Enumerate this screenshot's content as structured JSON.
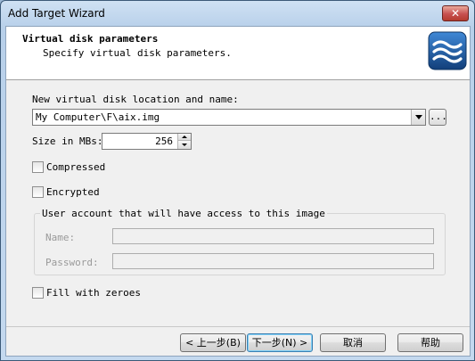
{
  "window": {
    "title": "Add Target Wizard",
    "close_label": "✕"
  },
  "header": {
    "title": "Virtual disk parameters",
    "subtitle": "Specify virtual disk parameters.",
    "icon": "waves-logo-icon"
  },
  "location": {
    "label": "New virtual disk location and name:",
    "value": "My Computer\\F\\aix.img",
    "browse_label": "..."
  },
  "size": {
    "label": "Size in MBs:",
    "value": "256"
  },
  "options": {
    "compressed": {
      "label": "Compressed",
      "checked": false
    },
    "encrypted": {
      "label": "Encrypted",
      "checked": false
    },
    "fill_zeroes": {
      "label": "Fill with zeroes",
      "checked": false
    }
  },
  "user_account": {
    "legend": "User account that will have access to this image",
    "name_label": "Name:",
    "password_label": "Password:",
    "name_value": "",
    "password_value": ""
  },
  "buttons": {
    "back": "< 上一步(B)",
    "next": "下一步(N) >",
    "cancel": "取消",
    "help": "帮助"
  },
  "colors": {
    "dialog_bg": "#f0f0f0",
    "header_bg": "#ffffff",
    "icon_bg": "#1f5fa3",
    "close_red": "#c75050"
  }
}
